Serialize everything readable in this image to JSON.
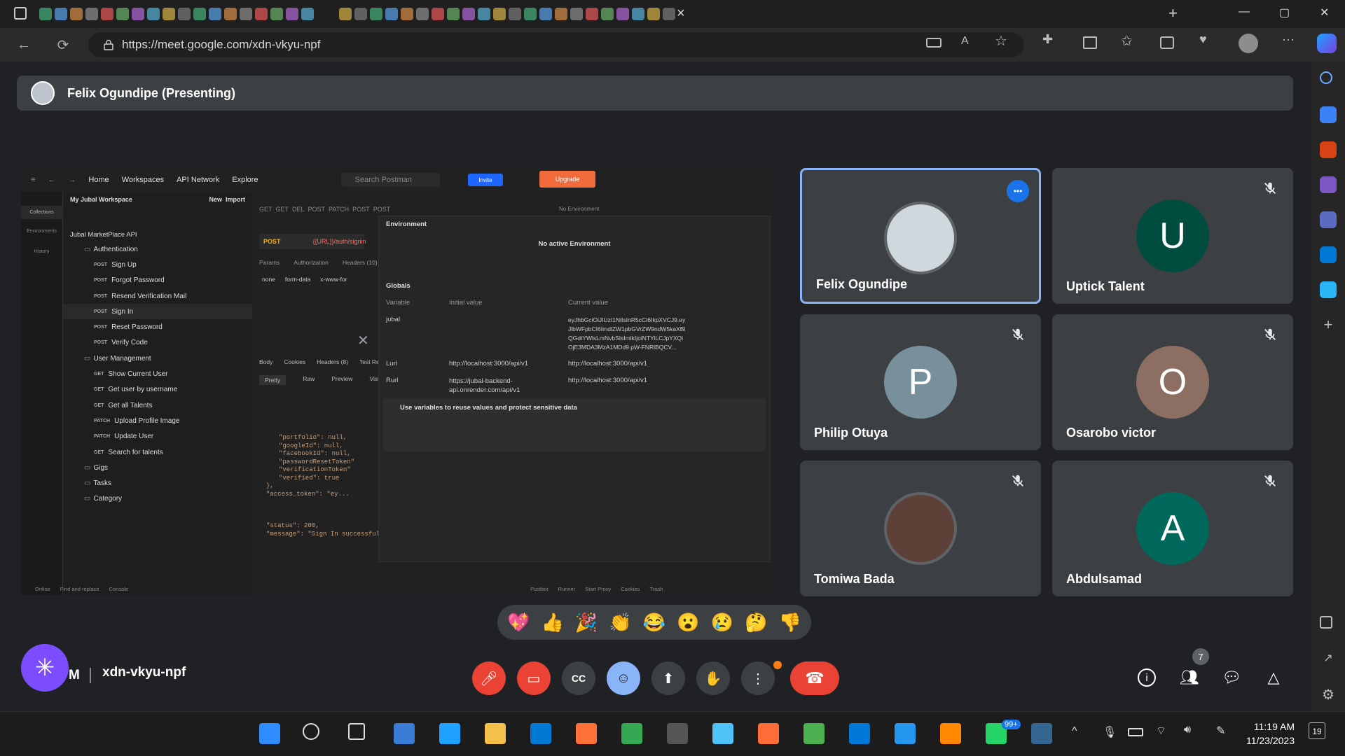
{
  "browser": {
    "url": "https://meet.google.com/xdn-vkyu-npf",
    "active_tab_close": "×",
    "new_tab": "+",
    "window_controls": [
      "—",
      "▢",
      "✕"
    ]
  },
  "meet": {
    "presenter_banner": "Felix Ogundipe (Presenting)",
    "meeting_code": "xdn-vkyu-npf",
    "host_letter": "M",
    "people_count": "7",
    "participants": [
      {
        "name": "Felix Ogundipe",
        "letter": "",
        "avatar_color": "#cfd8dc",
        "muted": false,
        "active": true
      },
      {
        "name": "Uptick Talent",
        "letter": "U",
        "avatar_color": "#004d40",
        "muted": true
      },
      {
        "name": "Philip Otuya",
        "letter": "P",
        "avatar_color": "#78909c",
        "muted": true
      },
      {
        "name": "Osarobo victor",
        "letter": "O",
        "avatar_color": "#8d6e63",
        "muted": true
      },
      {
        "name": "Tomiwa Bada",
        "letter": "",
        "avatar_color": "#5d4037",
        "muted": true
      },
      {
        "name": "Abdulsamad",
        "letter": "A",
        "avatar_color": "#00695c",
        "muted": true
      }
    ],
    "reactions": [
      "💖",
      "👍",
      "🎉",
      "👏",
      "😂",
      "😮",
      "😢",
      "🤔",
      "👎"
    ]
  },
  "postman": {
    "top_nav": [
      "Home",
      "Workspaces",
      "API Network",
      "Explore"
    ],
    "search_placeholder": "Search Postman",
    "invite_label": "Invite",
    "upgrade_label": "Upgrade",
    "workspace": "My Jubal Workspace",
    "new_label": "New",
    "import_label": "Import",
    "side_tabs": [
      "Collections",
      "Environments",
      "History"
    ],
    "collection": "Jubal MarketPlace API",
    "tree": [
      {
        "method": "",
        "label": "Authentication",
        "folder": true
      },
      {
        "method": "POST",
        "label": "Sign Up"
      },
      {
        "method": "POST",
        "label": "Forgot Password"
      },
      {
        "method": "POST",
        "label": "Resend Verification Mail"
      },
      {
        "method": "POST",
        "label": "Sign In"
      },
      {
        "method": "POST",
        "label": "Reset Password"
      },
      {
        "method": "POST",
        "label": "Verify Code"
      },
      {
        "method": "",
        "label": "User Management",
        "folder": true
      },
      {
        "method": "GET",
        "label": "Show Current User"
      },
      {
        "method": "GET",
        "label": "Get user by username"
      },
      {
        "method": "GET",
        "label": "Get all Talents"
      },
      {
        "method": "PATCH",
        "label": "Upload Profile Image"
      },
      {
        "method": "PATCH",
        "label": "Update User"
      },
      {
        "method": "GET",
        "label": "Search for talents"
      },
      {
        "method": "",
        "label": "Gigs",
        "folder": true
      },
      {
        "method": "",
        "label": "Tasks",
        "folder": true
      },
      {
        "method": "",
        "label": "Category",
        "folder": true
      }
    ],
    "request_method": "POST",
    "request_url": "{{URL}}/auth/signin",
    "request_tabs": [
      "Params",
      "Authorization",
      "Headers (10)"
    ],
    "body_types": [
      "none",
      "form-data",
      "x-www-for"
    ],
    "response_tabs": [
      "Body",
      "Cookies",
      "Headers (8)",
      "Test Resu"
    ],
    "response_views": [
      "Pretty",
      "Raw",
      "Preview",
      "Visual"
    ],
    "no_environment": "No Environment",
    "env_panel": {
      "title": "Environment",
      "no_active": "No active Environment",
      "globals": "Globals",
      "col_variable": "Variable",
      "col_initial": "Initial value",
      "col_current": "Current value",
      "rows": [
        {
          "var": "jubal",
          "initial": "",
          "current": "eyJhbGciOiJIUzI1NiIsInR5cCI6IkpXVCJ9.eyJlbWFpbCI6ImdlZW1pbGVrZW9ndW5kaXBl QGdtYWlsLmNvbSIsImlkIjoiNTYiLCJpYXQiOjE3MDA3MzA1MDd9.pW-FNRlBQCV..."
        },
        {
          "var": "Lurl",
          "initial": "http://localhost:3000/api/v1",
          "current": "http://localhost:3000/api/v1"
        },
        {
          "var": "Rurl",
          "initial": "https://jubal-backend-api.onrender.com/api/v1",
          "current": "http://localhost:3000/api/v1"
        }
      ],
      "tip_title": "Use variables to reuse values and protect sensitive data"
    },
    "code_lines": [
      "\"portfolio\": null,",
      "\"googleId\": null,",
      "\"facebookId\": null,",
      "\"passwordResetToken\"",
      "\"verificationToken\"",
      "\"verified\": true",
      "},",
      "\"access_token\": \"ey...",
      "\"status\": 200,",
      "\"message\": \"Sign In successful\""
    ],
    "footer": [
      "Online",
      "Find and replace",
      "Console",
      "Postbot",
      "Runner",
      "Start Proxy",
      "Cookies",
      "Trash"
    ]
  },
  "taskbar": {
    "time": "11:19 AM",
    "date": "11/23/2023",
    "whatsapp_badge": "99+",
    "notif_count": "19"
  }
}
